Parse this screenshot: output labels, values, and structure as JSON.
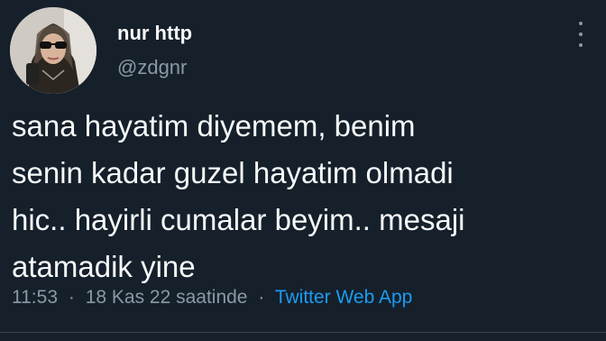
{
  "tweet": {
    "author": {
      "display_name": "nur http",
      "handle": "@zdgnr",
      "avatar_icon": "profile-photo"
    },
    "more_icon": "more-vertical-icon",
    "text_lines": [
      "sana hayatim diyemem, benim",
      "senin kadar guzel hayatim olmadi",
      "hic.. hayirli cumalar beyim.. mesaji",
      "atamadik yine"
    ],
    "meta": {
      "time": "11:53",
      "separator": "·",
      "date": "18 Kas 22 saatinde",
      "source": "Twitter Web App"
    }
  },
  "colors": {
    "background": "#15202b",
    "primary_text": "#f7f9f9",
    "secondary_text": "#8b98a5",
    "link": "#1d9bf0"
  }
}
